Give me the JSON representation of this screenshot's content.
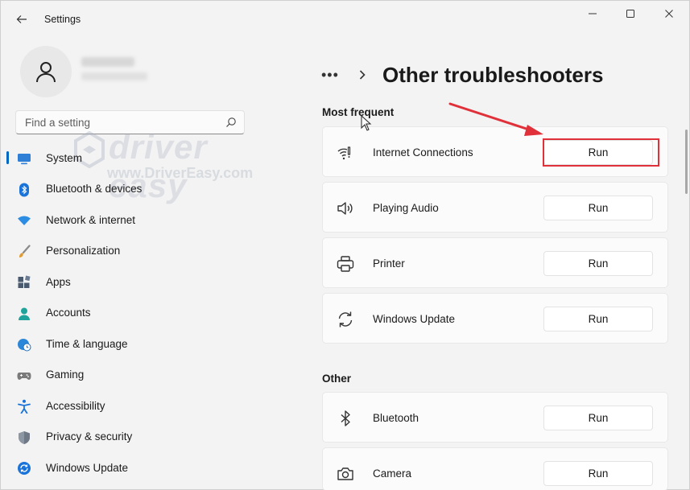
{
  "window": {
    "title": "Settings"
  },
  "search": {
    "placeholder": "Find a setting"
  },
  "sidebar": {
    "items": [
      {
        "label": "System",
        "icon": "monitor-icon",
        "active": true
      },
      {
        "label": "Bluetooth & devices",
        "icon": "bluetooth-icon"
      },
      {
        "label": "Network & internet",
        "icon": "wifi-icon"
      },
      {
        "label": "Personalization",
        "icon": "brush-icon"
      },
      {
        "label": "Apps",
        "icon": "apps-icon"
      },
      {
        "label": "Accounts",
        "icon": "person-icon"
      },
      {
        "label": "Time & language",
        "icon": "clock-globe-icon"
      },
      {
        "label": "Gaming",
        "icon": "gamepad-icon"
      },
      {
        "label": "Accessibility",
        "icon": "accessibility-icon"
      },
      {
        "label": "Privacy & security",
        "icon": "shield-icon"
      },
      {
        "label": "Windows Update",
        "icon": "update-icon"
      }
    ]
  },
  "watermark": {
    "brand": "driver easy",
    "url": "www.DriverEasy.com"
  },
  "main": {
    "breadcrumb_more": "•••",
    "title": "Other troubleshooters",
    "sections": [
      {
        "label": "Most frequent",
        "items": [
          {
            "label": "Internet Connections",
            "icon": "wifi-signal-icon",
            "button": "Run"
          },
          {
            "label": "Playing Audio",
            "icon": "speaker-icon",
            "button": "Run"
          },
          {
            "label": "Printer",
            "icon": "printer-icon",
            "button": "Run"
          },
          {
            "label": "Windows Update",
            "icon": "sync-icon",
            "button": "Run"
          }
        ]
      },
      {
        "label": "Other",
        "items": [
          {
            "label": "Bluetooth",
            "icon": "bluetooth-icon",
            "button": "Run"
          },
          {
            "label": "Camera",
            "icon": "camera-icon",
            "button": "Run"
          }
        ]
      }
    ]
  },
  "colors": {
    "accent": "#0067c0",
    "annotation": "#e0313a",
    "background": "#f3f3f3",
    "card": "#fbfbfb"
  }
}
